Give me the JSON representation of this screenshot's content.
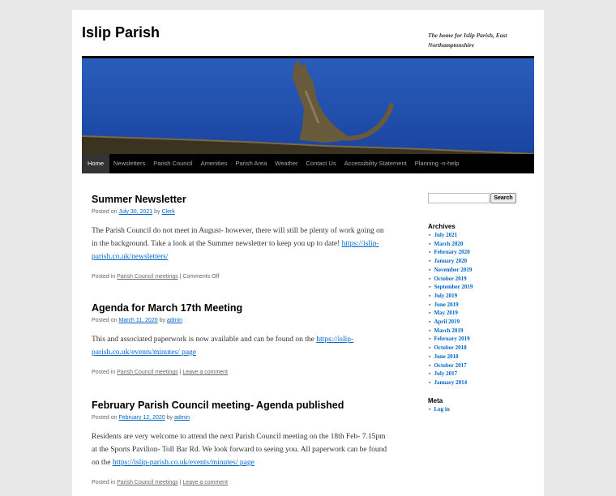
{
  "site": {
    "title": "Islip Parish",
    "description": "The home for Islip Parish, East Northamptonshire"
  },
  "nav": [
    "Home",
    "Newsletters",
    "Parish Council",
    "Amenities",
    "Parish Area",
    "Weather",
    "Contact Us",
    "Accessibility Statement",
    "Planning -n-help"
  ],
  "posts": [
    {
      "title": "Summer Newsletter",
      "posted_on": "Posted on",
      "date": "July 30, 2021",
      "by": "by",
      "author": "Clerk",
      "body": "The Parish Council do not meet in August- however, there will still be plenty of work going on in the background. Take a look at the Summer newsletter to keep you up to date!",
      "link": "https://islip-parish.co.uk/newsletters/",
      "posted_in": "Posted in",
      "category": "Parish Council meetings",
      "separator": "|",
      "comments": "Comments Off"
    },
    {
      "title": "Agenda for March 17th Meeting",
      "posted_on": "Posted on",
      "date": "March 11, 2020",
      "by": "by",
      "author": "admin",
      "body": "This and associated paperwork is now available and can be found on the",
      "link": "https://islip-parish.co.uk/events/minutes/ page",
      "posted_in": "Posted in",
      "category": "Parish Council meetings",
      "separator": "|",
      "comments": "Leave a comment"
    },
    {
      "title": "February Parish Council meeting- Agenda published",
      "posted_on": "Posted on",
      "date": "February 12, 2020",
      "by": "by",
      "author": "admin",
      "body": "Residents are very welcome to attend the next Parish Council meeting on the 18th Feb- 7.15pm at the Sports Pavilion- Toll Bar Rd. We look forward to seeing you. All paperwork can be found on the",
      "link": "https://islip-parish.co.uk/events/minutes/ page",
      "posted_in": "Posted in",
      "category": "Parish Council meetings",
      "separator": "|",
      "comments": "Leave a comment"
    }
  ],
  "sidebar": {
    "search_button": "Search",
    "archives_title": "Archives",
    "archives": [
      "July 2021",
      "March 2020",
      "February 2020",
      "January 2020",
      "November 2019",
      "October 2019",
      "September 2019",
      "July 2019",
      "June 2019",
      "May 2019",
      "April 2019",
      "March 2019",
      "February 2019",
      "October 2018",
      "June 2018",
      "October 2017",
      "July 2017",
      "January 2014"
    ],
    "meta_title": "Meta",
    "meta": [
      "Log in"
    ]
  },
  "colors": {
    "link": "#0066cc",
    "nav_bg": "#000000",
    "sky": "#1f4fa8"
  }
}
